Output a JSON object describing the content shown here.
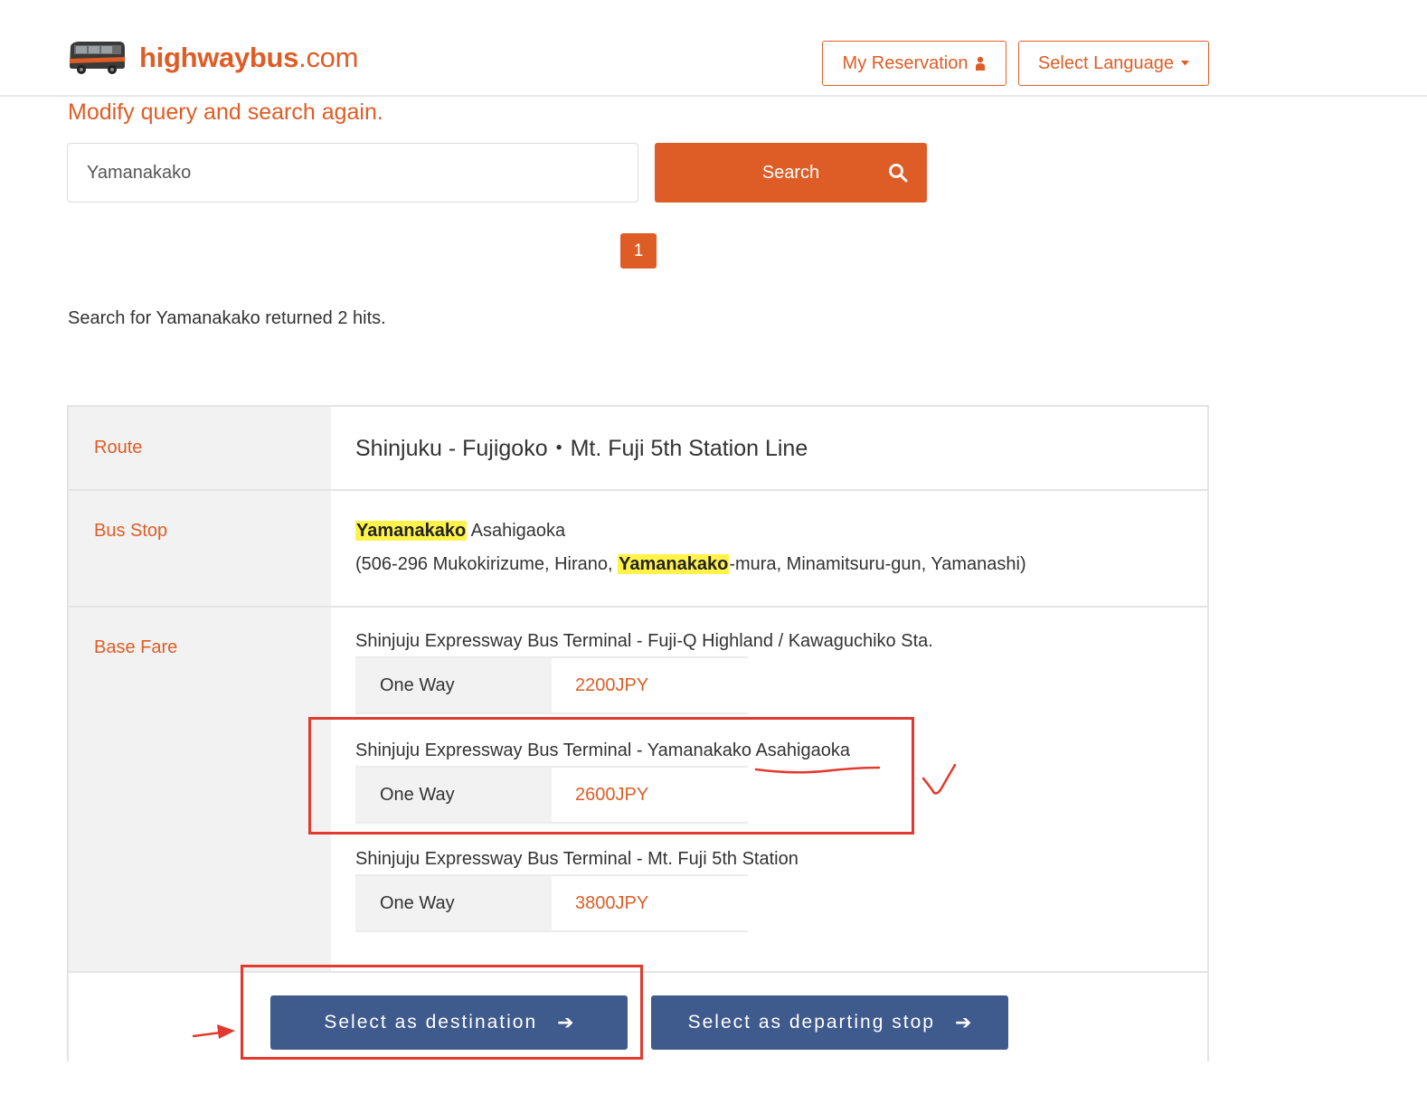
{
  "header": {
    "logo_main": "highwaybus",
    "logo_domain": ".com",
    "reservation_label": "My Reservation",
    "language_label": "Select Language"
  },
  "search": {
    "heading": "Modify query and search again.",
    "value": "Yamanakako",
    "button_label": "Search"
  },
  "pagination": {
    "current_page": "1"
  },
  "results": {
    "summary": "Search for Yamanakako returned 2 hits.",
    "items": [
      {
        "route_label": "Route",
        "route_name": "Shinjuku - Fujigoko・Mt. Fuji 5th Station Line",
        "stop_label": "Bus Stop",
        "stop_highlight": "Yamanakako",
        "stop_rest": " Asahigaoka",
        "addr_before": "(506-296 Mukokirizume, Hirano, ",
        "addr_highlight": "Yamanakako",
        "addr_after": "-mura, Minamitsuru-gun, Yamanashi)",
        "fare_label": "Base Fare",
        "fares": [
          {
            "section": "Shinjuju Expressway Bus Terminal - Fuji-Q Highland / Kawaguchiko Sta.",
            "type": "One Way",
            "price": "2200JPY"
          },
          {
            "section": "Shinjuju Expressway Bus Terminal - Yamanakako Asahigaoka",
            "type": "One Way",
            "price": "2600JPY"
          },
          {
            "section": "Shinjuju Expressway Bus Terminal - Mt. Fuji 5th Station",
            "type": "One Way",
            "price": "3800JPY"
          }
        ],
        "select_destination_label": "Select as destination",
        "select_departing_label": "Select as departing stop"
      }
    ]
  },
  "colors": {
    "brand_orange": "#de5d26",
    "action_blue": "#3f5a8c",
    "highlight_yellow": "#fff34a",
    "annotation_red": "#e23a2e"
  },
  "icons": [
    "bus-logo-icon",
    "user-icon",
    "caret-down-icon",
    "search-icon",
    "arrow-right-icon",
    "checkmark-annotation",
    "arrow-annotation"
  ]
}
